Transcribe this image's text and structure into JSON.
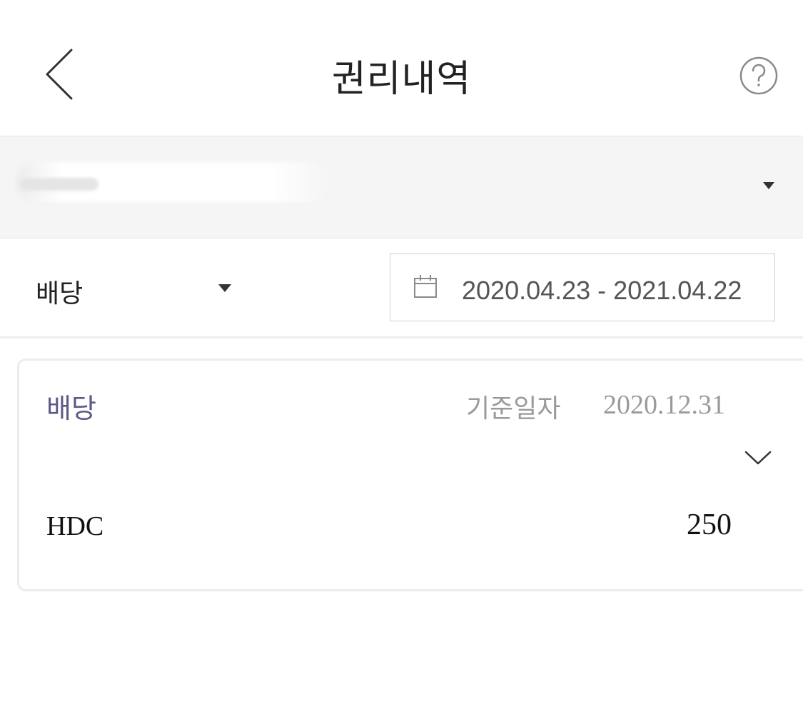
{
  "header": {
    "title": "권리내역",
    "back_icon": "chevron-left-icon",
    "help_icon": "question-circle-icon"
  },
  "account": {
    "caret_icon": "triangle-down-icon"
  },
  "filter": {
    "type_label": "배당",
    "type_caret_icon": "triangle-down-icon",
    "calendar_icon": "calendar-icon",
    "date_range": "2020.04.23 - 2021.04.22"
  },
  "records": [
    {
      "type": "배당",
      "date_label": "기준일자",
      "date_value": "2020.12.31",
      "expand_icon": "chevron-down-icon",
      "stock": "HDC",
      "amount": "250"
    }
  ],
  "colors": {
    "record_type": "#5a5a85",
    "muted_text": "#9a9a9a",
    "account_bar_bg": "#f5f5f5"
  }
}
